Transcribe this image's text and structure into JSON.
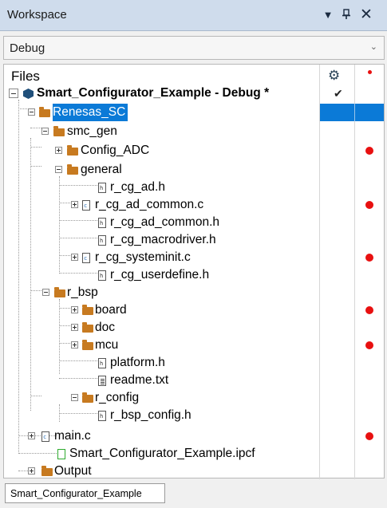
{
  "window": {
    "title": "Workspace",
    "buttons": {
      "dropdown": "▼",
      "pin": "ᵖ",
      "close": "✕"
    }
  },
  "config_select": {
    "value": "Debug"
  },
  "tree_header": {
    "files_label": "Files"
  },
  "tree": {
    "rows": [
      {
        "label": "Smart_Configurator_Example - Debug *",
        "icon": "workspace-cube-icon",
        "checked": true,
        "bold": true
      },
      {
        "label": "Renesas_SC",
        "icon": "folder-icon",
        "selected": true
      },
      {
        "label": "smc_gen",
        "icon": "folder-icon"
      },
      {
        "label": "Config_ADC",
        "icon": "folder-icon",
        "modified": true
      },
      {
        "label": "general",
        "icon": "folder-icon"
      },
      {
        "label": "r_cg_ad.h",
        "icon": "header-file-icon"
      },
      {
        "label": "r_cg_ad_common.c",
        "icon": "c-file-icon",
        "modified": true
      },
      {
        "label": "r_cg_ad_common.h",
        "icon": "header-file-icon"
      },
      {
        "label": "r_cg_macrodriver.h",
        "icon": "header-file-icon"
      },
      {
        "label": "r_cg_systeminit.c",
        "icon": "c-file-icon",
        "modified": true
      },
      {
        "label": "r_cg_userdefine.h",
        "icon": "header-file-icon"
      },
      {
        "label": "r_bsp",
        "icon": "folder-icon"
      },
      {
        "label": "board",
        "icon": "folder-icon",
        "modified": true
      },
      {
        "label": "doc",
        "icon": "folder-icon"
      },
      {
        "label": "mcu",
        "icon": "folder-icon",
        "modified": true
      },
      {
        "label": "platform.h",
        "icon": "header-file-icon"
      },
      {
        "label": "readme.txt",
        "icon": "text-file-icon"
      },
      {
        "label": "r_config",
        "icon": "folder-icon"
      },
      {
        "label": "r_bsp_config.h",
        "icon": "header-file-icon"
      },
      {
        "label": "main.c",
        "icon": "c-file-icon",
        "modified": true
      },
      {
        "label": "Smart_Configurator_Example.ipcf",
        "icon": "ipcf-file-icon"
      },
      {
        "label": "Output",
        "icon": "folder-icon"
      }
    ]
  },
  "bottom_tab": {
    "label": "Smart_Configurator_Example"
  },
  "colors": {
    "title_bar": "#cfdcec",
    "selection": "#0b7ad7",
    "folder": "#c77a20",
    "modified_dot": "#e81010",
    "cube": "#1f4f7a"
  }
}
